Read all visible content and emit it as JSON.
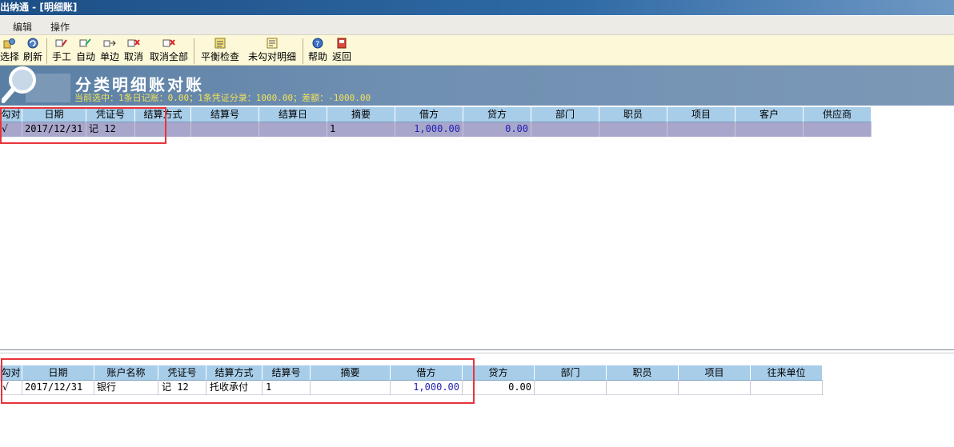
{
  "window": {
    "title": "出纳通 - [明细账]"
  },
  "menu": {
    "items": [
      "编辑",
      "操作"
    ]
  },
  "toolbar": {
    "buttons": {
      "select": "选择",
      "refresh": "刷新",
      "manual": "手工",
      "auto": "自动",
      "single": "单边",
      "cancel": "取消",
      "cancel_all": "取消全部",
      "balance_check": "平衡检查",
      "unchecked_detail": "未勾对明细",
      "help": "帮助",
      "back": "返回"
    }
  },
  "banner": {
    "title": "分类明细账对账",
    "subtitle": "当前选中：1条日记账：0.00；1条凭证分录：1000.00；差额：-1000.00"
  },
  "top_grid": {
    "headers": [
      "勾对",
      "日期",
      "凭证号",
      "结算方式",
      "结算号",
      "结算日",
      "摘要",
      "借方",
      "贷方",
      "部门",
      "职员",
      "项目",
      "客户",
      "供应商"
    ],
    "row": {
      "check": "√",
      "date": "2017/12/31",
      "voucher": "记  12",
      "method": "",
      "settle_no": "",
      "settle_date": "",
      "summary": "1",
      "debit": "1,000.00",
      "credit": "0.00",
      "dept": "",
      "staff": "",
      "project": "",
      "customer": "",
      "supplier": ""
    }
  },
  "bottom_grid": {
    "headers": [
      "勾对",
      "日期",
      "账户名称",
      "凭证号",
      "结算方式",
      "结算号",
      "摘要",
      "借方",
      "贷方",
      "部门",
      "职员",
      "项目",
      "往来单位"
    ],
    "row": {
      "check": "√",
      "date": "2017/12/31",
      "account": "银行",
      "voucher": "记 12",
      "method": "托收承付",
      "settle_no": "1",
      "summary": "",
      "debit": "1,000.00",
      "credit": "0.00",
      "dept": "",
      "staff": "",
      "project": "",
      "partner": ""
    }
  },
  "colors": {
    "header_bg": "#a7cde9",
    "selected_row_bg": "#a9a6cc",
    "amount_text": "#1f1fb0",
    "highlight_box": "#e8343a",
    "toolbar_bg": "#fdf9d8",
    "banner_bg": "#6f8fb1"
  }
}
